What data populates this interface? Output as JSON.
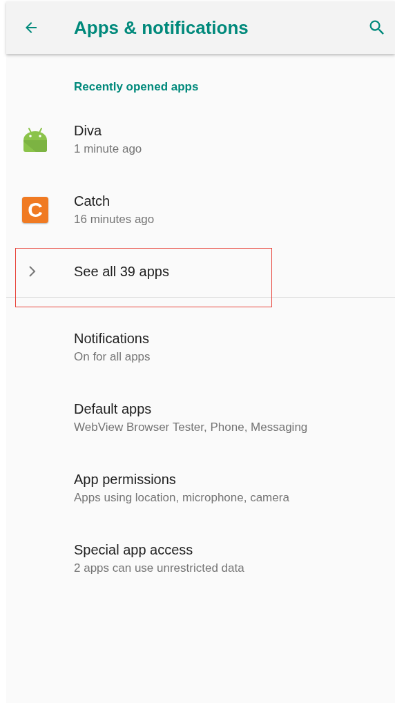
{
  "app_bar": {
    "title": "Apps & notifications"
  },
  "recent": {
    "header": "Recently opened apps",
    "apps": [
      {
        "name": "Diva",
        "time": "1 minute ago",
        "kind": "android"
      },
      {
        "name": "Catch",
        "time": "16 minutes ago",
        "kind": "letter",
        "letter": "C"
      }
    ],
    "see_all": {
      "label": "See all 39 apps",
      "highlighted": true
    }
  },
  "settings": [
    {
      "title": "Notifications",
      "summary": "On for all apps"
    },
    {
      "title": "Default apps",
      "summary": "WebView Browser Tester, Phone, Messaging"
    },
    {
      "title": "App permissions",
      "summary": "Apps using location, microphone, camera"
    },
    {
      "title": "Special app access",
      "summary": "2 apps can use unrestricted data"
    }
  ]
}
